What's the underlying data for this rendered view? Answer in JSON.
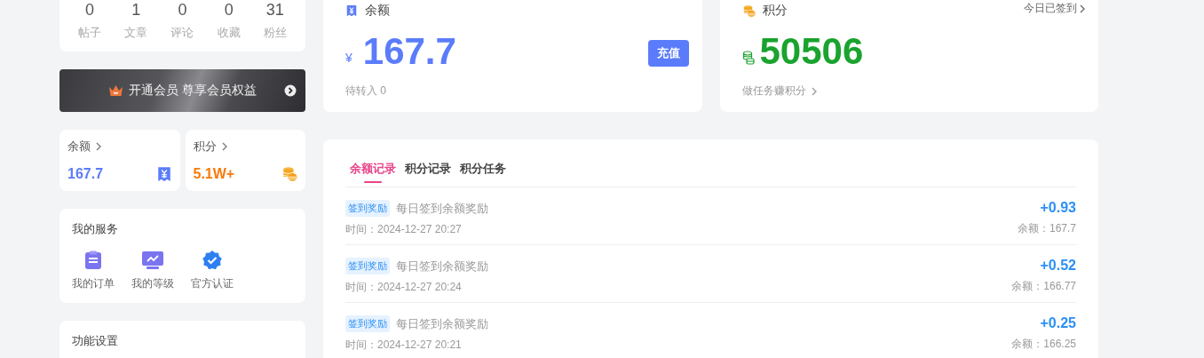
{
  "stats": [
    {
      "value": "0",
      "label": "帖子"
    },
    {
      "value": "1",
      "label": "文章"
    },
    {
      "value": "0",
      "label": "评论"
    },
    {
      "value": "0",
      "label": "收藏"
    },
    {
      "value": "31",
      "label": "粉丝"
    }
  ],
  "vip_banner": {
    "text": "开通会员 尊享会员权益"
  },
  "mini_cards": [
    {
      "kind": "balance",
      "title": "余额",
      "value": "167.7"
    },
    {
      "kind": "points",
      "title": "积分",
      "value": "5.1W+"
    }
  ],
  "services": {
    "title": "我的服务",
    "items": [
      {
        "kind": "order",
        "label": "我的订单"
      },
      {
        "kind": "level",
        "label": "我的等级"
      },
      {
        "kind": "verify",
        "label": "官方认证"
      }
    ]
  },
  "settings": {
    "title": "功能设置"
  },
  "balance_card": {
    "title": "余额",
    "currency": "¥",
    "amount": "167.7",
    "button": "充值",
    "pending": "待转入 0"
  },
  "points_card": {
    "title": "积分",
    "checkin": "今日已签到",
    "amount": "50506",
    "link": "做任务赚积分"
  },
  "records": {
    "tabs": [
      {
        "label": "余额记录",
        "selected": true
      },
      {
        "label": "积分记录",
        "selected": false
      },
      {
        "label": "积分任务",
        "selected": false
      }
    ],
    "rows": [
      {
        "tag": "签到奖励",
        "title": "每日签到余额奖励",
        "time": "时间：2024-12-27 20:27",
        "change": "+0.93",
        "balance": "余额：167.7"
      },
      {
        "tag": "签到奖励",
        "title": "每日签到余额奖励",
        "time": "时间：2024-12-27 20:24",
        "change": "+0.52",
        "balance": "余额：166.77"
      },
      {
        "tag": "签到奖励",
        "title": "每日签到余额奖励",
        "time": "时间：2024-12-27 20:21",
        "change": "+0.25",
        "balance": "余额：166.25"
      }
    ]
  }
}
